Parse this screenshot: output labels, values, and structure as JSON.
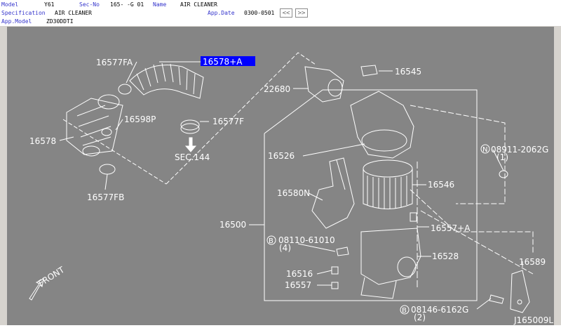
{
  "header": {
    "model_label": "Model",
    "model_value": "Y61",
    "secno_label": "Sec-No",
    "secno_value": "165-  -G 01",
    "name_label": "Name",
    "name_value": "AIR CLEANER",
    "spec_label": "Specification",
    "spec_value": "AIR CLEANER",
    "appdate_label": "App.Date",
    "appdate_value": "0300-0501",
    "appmodel_label": "App.Model",
    "appmodel_value": "ZD30DDTI",
    "prev_button": "<<",
    "next_button": ">>"
  },
  "diagram": {
    "selected_part": "16578+A",
    "parts": {
      "p16577FA": "16577FA",
      "p16578": "16578",
      "p16598P": "16598P",
      "p16577F": "16577F",
      "sec144": "SEC.144",
      "p16577FB": "16577FB",
      "p22680": "22680",
      "p16545": "16545",
      "p16526": "16526",
      "p08911": "08911-2062G",
      "p08911_qty": "(1)",
      "p16546": "16546",
      "p16580N": "16580N",
      "p16500": "16500",
      "p16557A": "16557+A",
      "p08110": "08110-61010",
      "p08110_qty": "(4)",
      "p16528": "16528",
      "p16589": "16589",
      "p16516": "16516",
      "p16557": "16557",
      "p08146": "08146-6162G",
      "p08146_qty": "(2)",
      "front": "FRONT",
      "drawing_code": "J165009L"
    },
    "icons": [
      "circle-n-icon",
      "circle-b-icon",
      "front-arrow-icon",
      "down-arrow-icon"
    ],
    "colors": {
      "background": "#858585",
      "lines": "#ffffff",
      "highlight": "#0000ff"
    }
  }
}
